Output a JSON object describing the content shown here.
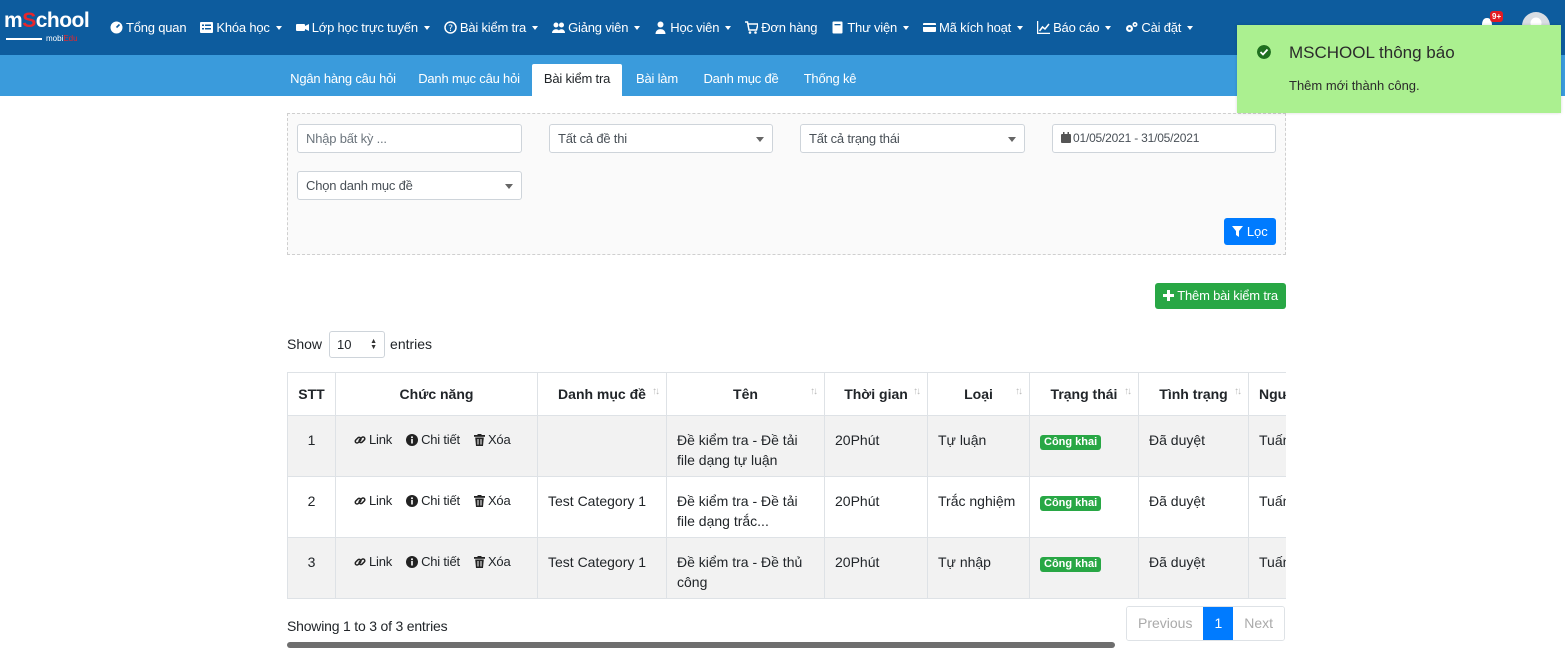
{
  "brand": {
    "logo_left": "m",
    "logo_o": "S",
    "logo_right": "chool",
    "logo_sub_a": "mobi",
    "logo_sub_b": "Edu"
  },
  "menu": [
    {
      "label": "Tổng quan",
      "icon": "dashboard-icon",
      "caret": false
    },
    {
      "label": "Khóa học",
      "icon": "list-icon",
      "caret": true
    },
    {
      "label": "Lớp học trực tuyến",
      "icon": "video-icon",
      "caret": true
    },
    {
      "label": "Bài kiểm tra",
      "icon": "question-circle-icon",
      "caret": true
    },
    {
      "label": "Giảng viên",
      "icon": "users-icon",
      "caret": true
    },
    {
      "label": "Học viên",
      "icon": "user-icon",
      "caret": true
    },
    {
      "label": "Đơn hàng",
      "icon": "cart-icon",
      "caret": false
    },
    {
      "label": "Thư viện",
      "icon": "book-icon",
      "caret": true
    },
    {
      "label": "Mã kích hoạt",
      "icon": "card-icon",
      "caret": true
    },
    {
      "label": "Báo cáo",
      "icon": "chart-icon",
      "caret": true
    },
    {
      "label": "Cài đặt",
      "icon": "gears-icon",
      "caret": true
    }
  ],
  "notifications": {
    "badge": "9+"
  },
  "tabs": [
    "Ngân hàng câu hỏi",
    "Danh mục câu hỏi",
    "Bài kiểm tra",
    "Bài làm",
    "Danh mục đề",
    "Thống kê"
  ],
  "filters": {
    "search_placeholder": "Nhập bất kỳ ...",
    "exam_select": "Tất cả đề thi",
    "status_select": "Tất cả trạng thái",
    "date_range": "01/05/2021 - 31/05/2021",
    "category_select": "Chọn danh mục đề",
    "filter_button": "Lọc"
  },
  "add_button": "Thêm bài kiểm tra",
  "show": {
    "prefix": "Show",
    "value": "10",
    "suffix": "entries"
  },
  "table": {
    "headers": [
      "STT",
      "Chức năng",
      "Danh mục đề",
      "Tên",
      "Thời gian",
      "Loại",
      "Trạng thái",
      "Tình trạng",
      "Người"
    ],
    "actions": {
      "link": "Link",
      "detail": "Chi tiết",
      "delete": "Xóa"
    },
    "rows": [
      {
        "stt": "1",
        "category": "",
        "name": "Đề kiểm tra - Đề tải file dạng tự luận",
        "time": "20Phút",
        "type": "Tự luận",
        "status": "Công khai",
        "state": "Đã duyệt",
        "person": "Tuấn"
      },
      {
        "stt": "2",
        "category": "Test Category 1",
        "name": "Đề kiểm tra - Đề tải file dạng trắc...",
        "time": "20Phút",
        "type": "Trắc nghiệm",
        "status": "Công khai",
        "state": "Đã duyệt",
        "person": "Tuấn"
      },
      {
        "stt": "3",
        "category": "Test Category 1",
        "name": "Đề kiểm tra - Đề thủ công",
        "time": "20Phút",
        "type": "Tự nhập",
        "status": "Công khai",
        "state": "Đã duyệt",
        "person": "Tuấn"
      }
    ]
  },
  "footer": {
    "info": "Showing 1 to 3 of 3 entries",
    "prev": "Previous",
    "page": "1",
    "next": "Next"
  },
  "toast": {
    "title": "MSCHOOL thông báo",
    "message": "Thêm mới thành công."
  }
}
